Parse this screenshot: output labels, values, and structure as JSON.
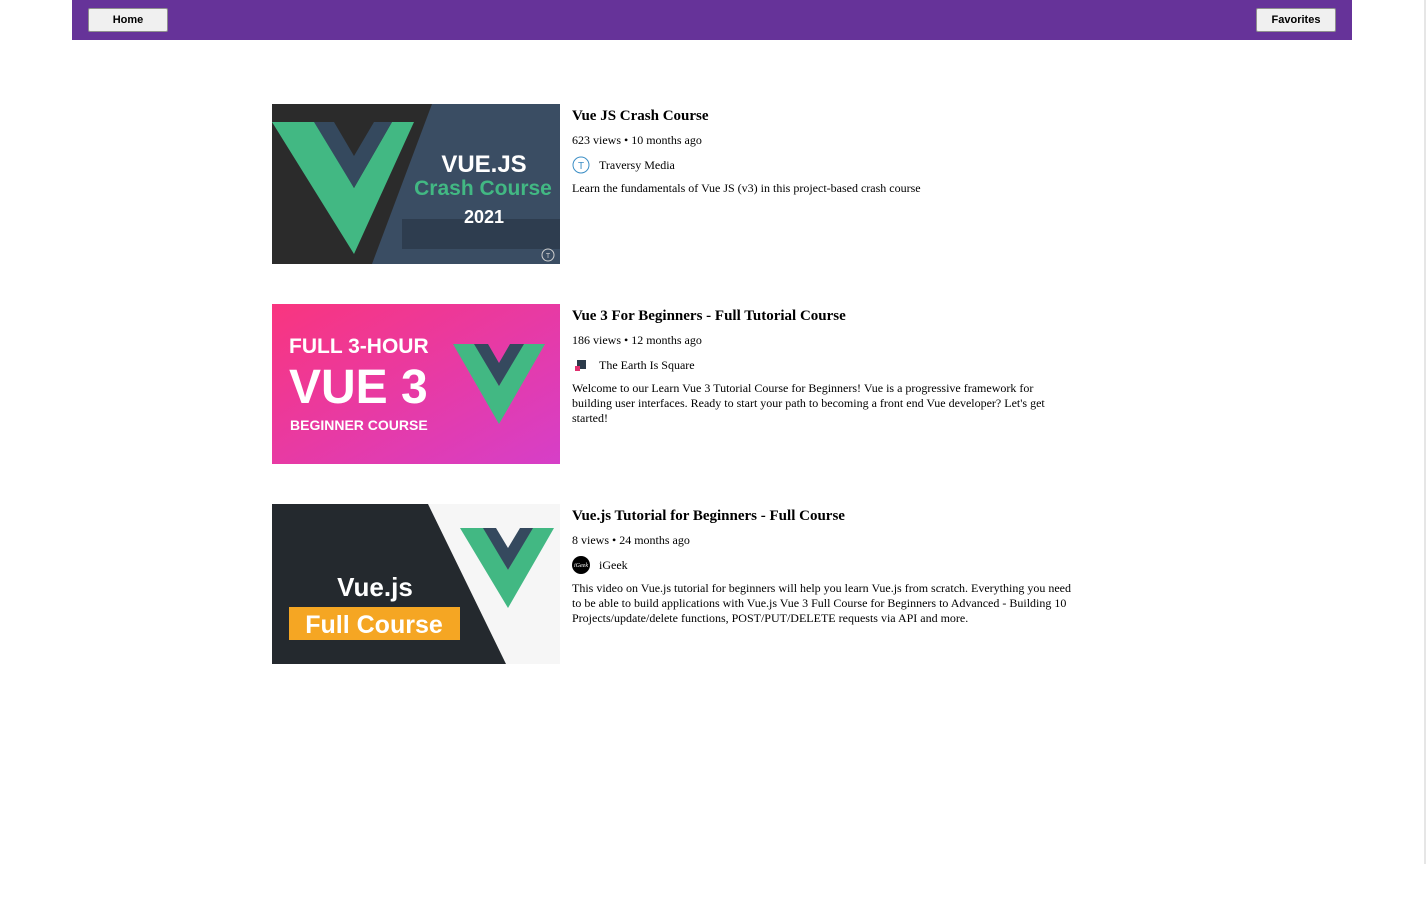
{
  "nav": {
    "home_label": "Home",
    "favorites_label": "Favorites"
  },
  "videos": [
    {
      "title": "Vue JS Crash Course",
      "meta": "623 views • 10 months ago",
      "channel": "Traversy Media",
      "description": "Learn the fundamentals of Vue JS (v3) in this project-based crash course",
      "thumbnail": {
        "line1": "VUE.JS",
        "line2": "Crash Course",
        "line3": "2021"
      },
      "avatar_icon": "traversy-logo-icon"
    },
    {
      "title": "Vue 3 For Beginners - Full Tutorial Course",
      "meta": "186 views • 12 months ago",
      "channel": "The Earth Is Square",
      "description": "Welcome to our Learn Vue 3 Tutorial Course for Beginners! Vue is a progressive framework for building user interfaces. Ready to start your path to becoming a front end Vue developer? Let's get started!",
      "thumbnail": {
        "line1": "FULL 3-HOUR",
        "line2": "VUE 3",
        "line3": "BEGINNER COURSE"
      },
      "avatar_icon": "square-logo-icon"
    },
    {
      "title": "Vue.js Tutorial for Beginners - Full Course",
      "meta": "8 views • 24 months ago",
      "channel": "iGeek",
      "description": "This video on Vue.js tutorial for beginners will help you learn Vue.js from scratch. Everything you need to be able to build applications with Vue.js Vue 3 Full Course for Beginners to Advanced - Building 10 Projects/update/delete functions, POST/PUT/DELETE requests via API and more.",
      "thumbnail": {
        "line1": "Vue.js",
        "line2": "Full Course"
      },
      "avatar_icon": "igeek-logo-icon"
    }
  ],
  "colors": {
    "nav_bg": "#663399",
    "vue_green": "#42b883",
    "vue_dark": "#35495e",
    "pink": "#f0388f",
    "yellow": "#f5a623"
  }
}
